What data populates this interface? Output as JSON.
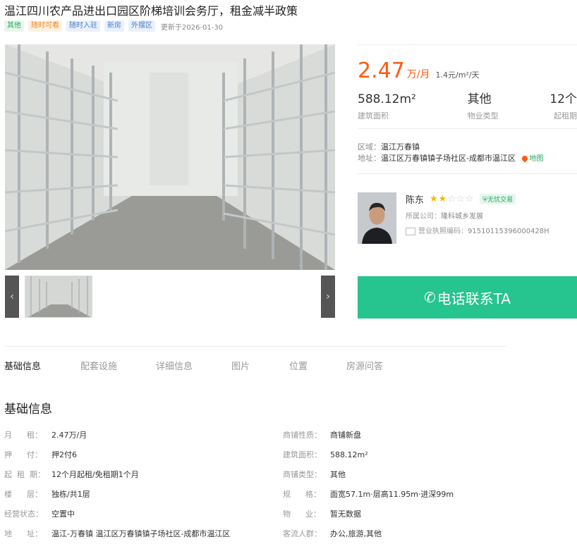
{
  "listing": {
    "title": "温江四川农产品进出口园区阶梯培训会务厅，租金减半政策",
    "tags": [
      "其他",
      "随时可看",
      "随时入驻",
      "新房",
      "外摆区"
    ],
    "updated": "更新于2026-01-30"
  },
  "gallery": {
    "prev_icon": "‹",
    "next_icon": "›"
  },
  "price": {
    "value": "2.47",
    "unit": "万/月",
    "per_sqm": "1.4元/m²/天"
  },
  "stats": [
    {
      "value": "588.12m²",
      "label": "建筑面积"
    },
    {
      "value": "其他",
      "label": "物业类型"
    },
    {
      "value": "12个",
      "label": "起租期"
    }
  ],
  "location": {
    "district_label": "区域：",
    "district": "温江万春镇",
    "address_label": "地址：",
    "address": "温江区万春镇镇子场社区-成都市温江区",
    "map_label": "地图"
  },
  "agent": {
    "name": "陈东",
    "rating": 2,
    "rating_max": 5,
    "badge": "无忧交易",
    "company_label": "所属公司：",
    "company": "隆科城乡发展",
    "license_label": "营业执照编码：",
    "license": "91510115396000428H"
  },
  "call_button": "电话联系TA",
  "tabs": [
    "基础信息",
    "配套设施",
    "详细信息",
    "图片",
    "位置",
    "房源问答"
  ],
  "basic_info": {
    "title": "基础信息",
    "left": [
      {
        "k": "月      租：",
        "v": "2.47万/月"
      },
      {
        "k": "押      付：",
        "v": "押2付6"
      },
      {
        "k": "起  租  期：",
        "v": "12个月起租/免租期1个月"
      },
      {
        "k": "楼      层：",
        "v": "独栋/共1层"
      },
      {
        "k": "经营状态：",
        "v": "空置中"
      },
      {
        "k": "地      址：",
        "v": "温江-万春镇 温江区万春镇镇子场社区-成都市温江区"
      }
    ],
    "right": [
      {
        "k": "商铺性质：",
        "v": "商铺新盘"
      },
      {
        "k": "建筑面积：",
        "v": "588.12m²"
      },
      {
        "k": "商铺类型：",
        "v": "其他"
      },
      {
        "k": "规      格：",
        "v": "面宽57.1m·层高11.95m·进深99m"
      },
      {
        "k": "物      业：",
        "v": "暂无数据"
      },
      {
        "k": "客流人群：",
        "v": "办公,旅游,其他"
      }
    ]
  },
  "colors": {
    "price": "#ff5a14",
    "call": "#26c48f",
    "star": "#f5b800"
  }
}
